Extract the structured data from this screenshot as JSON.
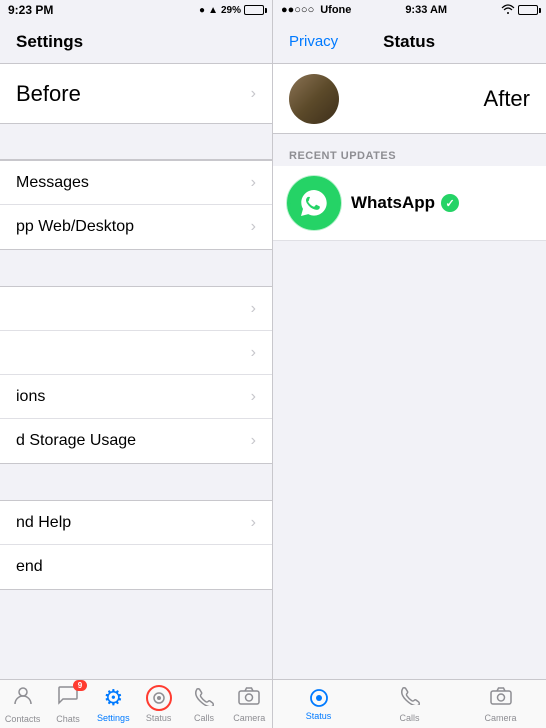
{
  "left": {
    "status_bar": {
      "time": "9:23 PM",
      "icons": "● ▲ 29%"
    },
    "nav": {
      "title": "Settings"
    },
    "before_label": "Before",
    "menu_items": [
      {
        "id": "messages",
        "label": "Messages"
      },
      {
        "id": "web_desktop",
        "label": "pp Web/Desktop"
      }
    ],
    "extra_items": [
      {
        "id": "item1",
        "label": ""
      },
      {
        "id": "item2",
        "label": ""
      },
      {
        "id": "ions",
        "label": "ions"
      },
      {
        "id": "storage",
        "label": "d Storage Usage"
      }
    ],
    "bottom_items": [
      {
        "id": "help",
        "label": "nd Help"
      },
      {
        "id": "end",
        "label": "end"
      }
    ],
    "tab_bar": {
      "items": [
        {
          "id": "contacts",
          "icon": "👤",
          "label": "Contacts",
          "active": false,
          "badge": null
        },
        {
          "id": "chats",
          "icon": "💬",
          "label": "Chats",
          "active": false,
          "badge": "9"
        },
        {
          "id": "settings",
          "icon": "⚙️",
          "label": "Settings",
          "active": true,
          "badge": null
        },
        {
          "id": "status",
          "icon": "⊙",
          "label": "Status",
          "active": false,
          "badge": null,
          "highlight": true
        },
        {
          "id": "calls",
          "icon": "📞",
          "label": "Calls",
          "active": false,
          "badge": null
        },
        {
          "id": "camera",
          "icon": "📷",
          "label": "Camera",
          "active": false,
          "badge": null
        }
      ]
    }
  },
  "right": {
    "status_bar": {
      "signal": "●●○○○",
      "carrier": "Ufone",
      "time": "9:33 AM",
      "wifi": "▲"
    },
    "nav": {
      "back_label": "Privacy",
      "title": "Status"
    },
    "after_label": "After",
    "recent_updates_header": "RECENT UPDATES",
    "whatsapp_item": {
      "name": "WhatsApp",
      "verified": "✓"
    },
    "tab_bar": {
      "items": [
        {
          "id": "status_active",
          "icon": "⊙",
          "label": "Status",
          "active": true,
          "highlight_border": true
        },
        {
          "id": "calls",
          "icon": "📞",
          "label": "Calls",
          "active": false
        },
        {
          "id": "camera",
          "icon": "📷",
          "label": "Camera",
          "active": false
        }
      ]
    }
  }
}
